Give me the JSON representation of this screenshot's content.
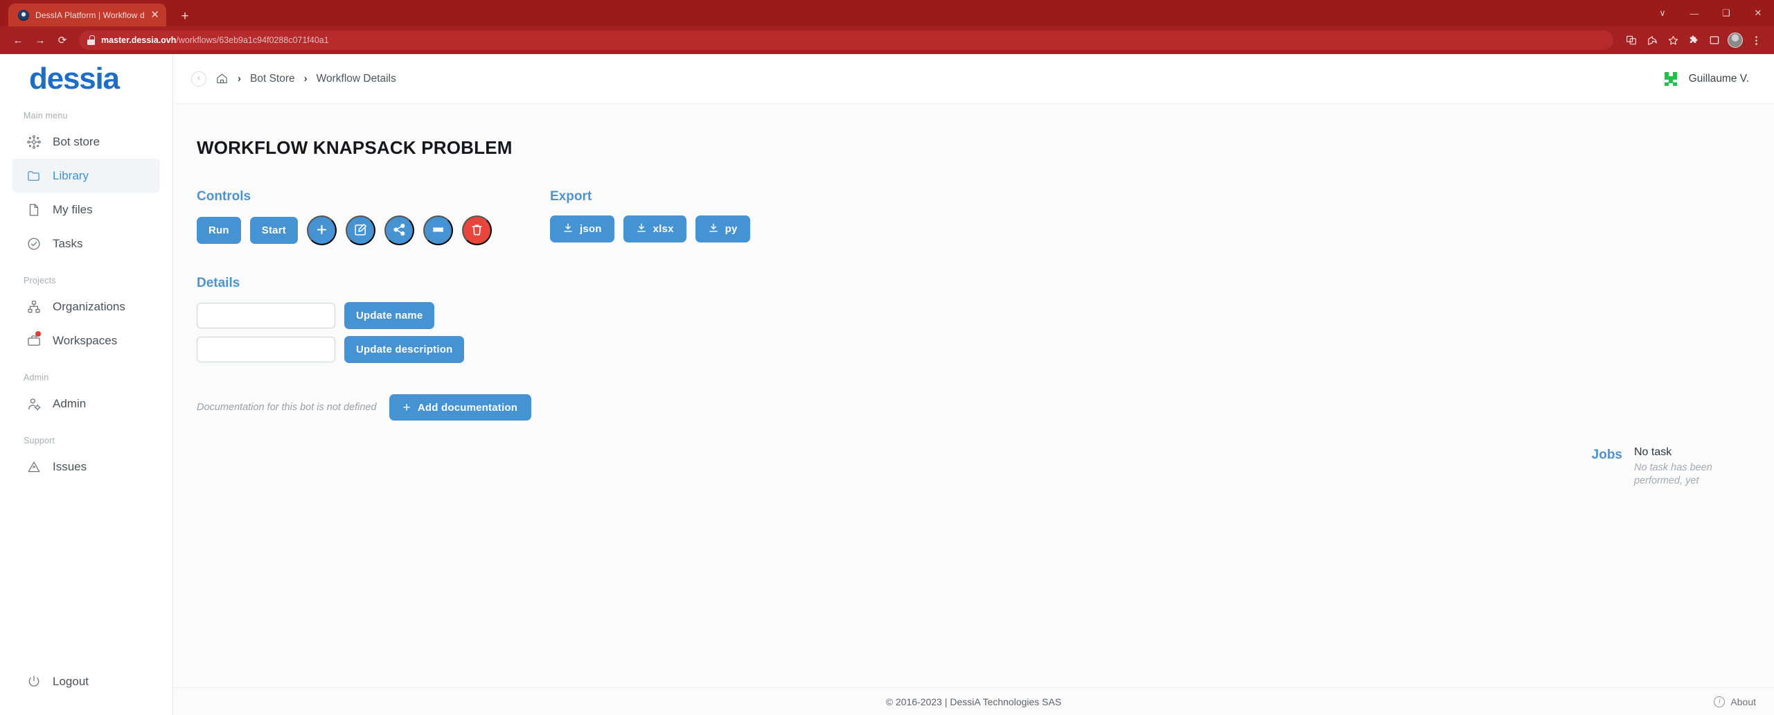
{
  "browser": {
    "tab": {
      "title": "DessIA Platform | Workflow detai",
      "favicon": "dessia-favicon",
      "close": "✕"
    },
    "new_tab": "+",
    "window_controls": [
      "∨",
      "—",
      "❑",
      "✕"
    ],
    "nav": {
      "back": "←",
      "forward": "→",
      "reload": "⟳"
    },
    "url": {
      "host": "master.dessia.ovh",
      "path": "/workflows/63eb9a1c94f0288c071f40a1"
    },
    "toolbar_icons": [
      "translate-icon",
      "share-icon",
      "bookmark-star-icon",
      "extensions-icon",
      "side-panel-icon",
      "profile-avatar",
      "chrome-menu-icon"
    ]
  },
  "sidebar": {
    "brand": "dessia",
    "groups": [
      {
        "label": "Main menu",
        "items": [
          {
            "label": "Bot store",
            "icon": "network-nodes-icon",
            "active": false
          },
          {
            "label": "Library",
            "icon": "folder-icon",
            "active": true
          },
          {
            "label": "My files",
            "icon": "file-icon",
            "active": false
          },
          {
            "label": "Tasks",
            "icon": "check-circle-icon",
            "active": false
          }
        ]
      },
      {
        "label": "Projects",
        "items": [
          {
            "label": "Organizations",
            "icon": "org-hierarchy-icon",
            "active": false
          },
          {
            "label": "Workspaces",
            "icon": "briefcase-icon",
            "active": false,
            "badge": true
          }
        ]
      },
      {
        "label": "Admin",
        "items": [
          {
            "label": "Admin",
            "icon": "user-gear-icon",
            "active": false
          }
        ]
      },
      {
        "label": "Support",
        "items": [
          {
            "label": "Issues",
            "icon": "warning-triangle-icon",
            "active": false
          }
        ]
      }
    ],
    "logout": {
      "label": "Logout",
      "icon": "power-icon"
    }
  },
  "topbar": {
    "collapse": "‹",
    "home_icon": "home-icon",
    "separator": "›",
    "breadcrumbs": [
      "Bot Store",
      "Workflow Details"
    ],
    "user": {
      "name": "Guillaume V.",
      "avatar": "pixel-avatar-green",
      "avatar_color": "#1fc24a"
    }
  },
  "main": {
    "page_title": "WORKFLOW KNAPSACK PROBLEM",
    "controls": {
      "title": "Controls",
      "buttons": [
        {
          "label": "Run",
          "name": "run-button",
          "style": "text"
        },
        {
          "label": "Start",
          "name": "start-button",
          "style": "text"
        }
      ],
      "icon_buttons": [
        {
          "icon": "plus-icon",
          "name": "add-button",
          "danger": false
        },
        {
          "icon": "edit-pencil-icon",
          "name": "edit-button",
          "danger": false
        },
        {
          "icon": "share-nodes-icon",
          "name": "share-button",
          "danger": false
        },
        {
          "icon": "ticket-icon",
          "name": "ticket-button",
          "danger": false
        },
        {
          "icon": "trash-icon",
          "name": "delete-button",
          "danger": true
        }
      ]
    },
    "export": {
      "title": "Export",
      "buttons": [
        {
          "label": "json",
          "icon": "download-icon"
        },
        {
          "label": "xlsx",
          "icon": "download-icon"
        },
        {
          "label": "py",
          "icon": "download-icon"
        }
      ]
    },
    "details": {
      "title": "Details",
      "name_input": {
        "value": "",
        "placeholder": ""
      },
      "name_button": "Update name",
      "description_input": {
        "value": "",
        "placeholder": ""
      },
      "description_button": "Update description",
      "doc_note": "Documentation for this bot is not defined",
      "doc_button": "Add documentation",
      "doc_button_plus": "+"
    },
    "jobs": {
      "label": "Jobs",
      "title": "No task",
      "subtitle": "No task has been performed, yet"
    }
  },
  "footer": {
    "copyright": "© 2016-2023 | DessiA Technologies SAS",
    "about": "About",
    "info_icon": "i"
  },
  "colors": {
    "browser_chrome": "#9b1b1b",
    "browser_toolbar": "#a52020",
    "accent_blue": "#4593d2",
    "brand_blue": "#1e6ec8",
    "danger_red": "#e8453c",
    "avatar_green": "#1fc24a"
  }
}
